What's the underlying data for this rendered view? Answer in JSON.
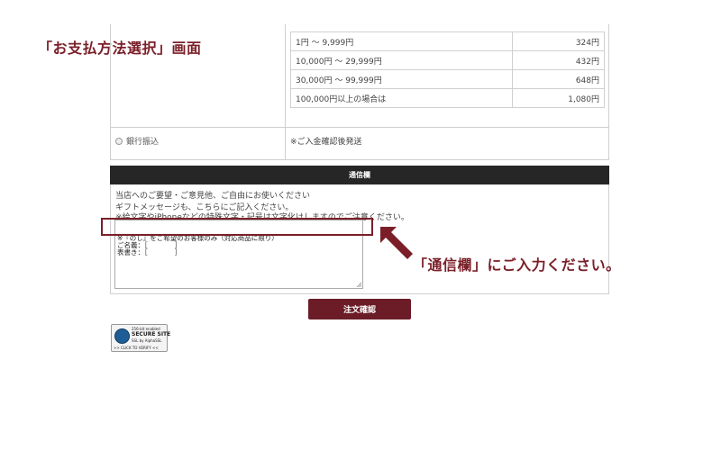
{
  "annotations": {
    "page_title": "「お支払方法選択」画面",
    "callout": "「通信欄」にご入力ください。"
  },
  "payment": {
    "fee_rows": [
      {
        "range": "1円 ～ 9,999円",
        "fee": "324円"
      },
      {
        "range": "10,000円 ～ 29,999円",
        "fee": "432円"
      },
      {
        "range": "30,000円 ～ 99,999円",
        "fee": "648円"
      },
      {
        "range": "100,000円以上の場合は",
        "fee": "1,080円"
      }
    ],
    "bank_transfer_label": "銀行振込",
    "bank_transfer_note": "※ご入金確認後発送"
  },
  "message": {
    "header": "通信欄",
    "lines": [
      "当店へのご要望・ご意見他、ご自由にお使いください",
      "ギフトメッセージも、こちらにご記入ください。",
      "※絵文字やiPhoneなどの特殊文字・記号は文字化けしますのでご注意ください。"
    ],
    "textarea_lines": [
      "※『のし』をご希望のお客様のみ（対応商品に限り）",
      "ご名義：［　　　　］",
      "表書き：［　　　　］"
    ]
  },
  "actions": {
    "confirm_label": "注文確認"
  },
  "badge": {
    "bits": "256-bit enabled",
    "secure": "SECURE SITE",
    "alpha": "SSL by AlphaSSL",
    "verify": ">> CLICK TO VERIFY <<"
  },
  "colors": {
    "accent": "#7a1f28",
    "button": "#6b1c26",
    "header_bg": "#262626"
  }
}
